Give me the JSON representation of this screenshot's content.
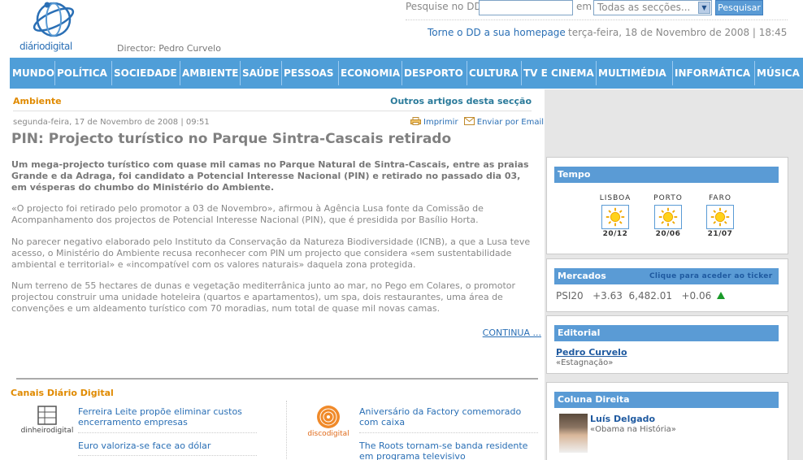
{
  "header": {
    "logo_text_a": "diário",
    "logo_text_b": "digital",
    "director": "Director: Pedro Curvelo",
    "search_label": "Pesquise no DD",
    "search_value": "",
    "in_label": "em",
    "section_select": "Todas as secções...",
    "search_button": "Pesquisar",
    "homepage_link": "Torne o DD a sua homepage",
    "datetime": "terça-feira, 18 de Novembro de 2008 | 18:45"
  },
  "nav": [
    "MUNDO",
    "POLÍTICA",
    "SOCIEDADE",
    "AMBIENTE",
    "SAÚDE",
    "PESSOAS",
    "ECONOMIA",
    "DESPORTO",
    "CULTURA",
    "TV E CINEMA",
    "MULTIMÉDIA",
    "INFORMÁTICA",
    "MÚSICA"
  ],
  "article": {
    "section": "Ambiente",
    "other_articles": "Outros artigos desta secção",
    "date": "segunda-feira, 17 de Novembro de 2008 | 09:51",
    "print": "Imprimir",
    "email": "Enviar por Email",
    "title": "PIN: Projecto turístico no Parque Sintra-Cascais retirado",
    "lead": "Um mega-projecto turístico com quase mil camas no Parque Natural de Sintra-Cascais, entre as praias Grande e da Adraga, foi candidato a Potencial Interesse Nacional (PIN) e retirado no passado dia 03, em vésperas do chumbo do Ministério do Ambiente.",
    "paragraphs": [
      "«O projecto foi retirado pelo promotor a 03 de Novembro», afirmou à Agência Lusa fonte da Comissão de Acompanhamento dos projectos de Potencial Interesse Nacional (PIN), que é presidida por Basílio Horta.",
      "No parecer negativo elaborado pelo Instituto da Conservação da Natureza Biodiversidade (ICNB), a que a Lusa teve acesso, o Ministério do Ambiente recusa reconhecer com PIN um projecto que considera «sem sustentabilidade ambiental e territorial» e «incompatível com os valores naturais» daquela zona protegida.",
      "Num terreno de 55 hectares de dunas e vegetação mediterrânica junto ao mar, no Pego em Colares, o promotor projectou construir uma unidade hoteleira (quartos e apartamentos), um spa, dois restaurantes, uma área de convenções e um aldeamento turístico com 70 moradias, num total de quase mil novas camas."
    ],
    "continue": "CONTINUA ..."
  },
  "channels": {
    "title": "Canais Diário Digital",
    "dinheiro_logo_a": "dinheiro",
    "dinheiro_logo_b": "digital",
    "disco_logo_a": "disco",
    "disco_logo_b": "digital",
    "left_items": [
      "Ferreira Leite propõe eliminar custos encerramento empresas",
      "Euro valoriza-se face ao dólar"
    ],
    "right_items": [
      "Aniversário da Factory comemorado com caixa",
      "The Roots tornam-se banda residente em programa televisivo"
    ]
  },
  "sidebar": {
    "weather": {
      "title": "Tempo",
      "cities": [
        {
          "name": "LISBOA",
          "temp": "20/12"
        },
        {
          "name": "PORTO",
          "temp": "20/06"
        },
        {
          "name": "FARO",
          "temp": "21/07"
        }
      ]
    },
    "markets": {
      "title": "Mercados",
      "ticker_link": "Clique para aceder ao ticker",
      "index": "PSI20",
      "change_pct": "+3.63",
      "value": "6,482.01",
      "change": "+0.06"
    },
    "editorial": {
      "title": "Editorial",
      "author": "Pedro Curvelo",
      "desc": "«Estagnação»"
    },
    "column": {
      "title": "Coluna Direita",
      "author": "Luís Delgado",
      "desc": "«Obama na História»"
    }
  },
  "colors": {
    "nav_blue": "#4f9ed8",
    "box_header": "#5a9bd5",
    "section_orange": "#e08a00",
    "link_blue": "#2a6fb5",
    "market_up": "#1a9a2a"
  }
}
